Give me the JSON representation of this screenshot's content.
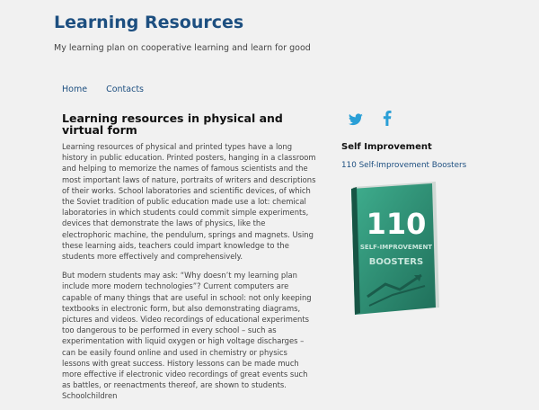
{
  "site": {
    "title": "Learning Resources",
    "tagline": "My learning plan on cooperative learning and learn for good"
  },
  "nav": {
    "items": [
      {
        "label": "Home"
      },
      {
        "label": "Contacts"
      }
    ]
  },
  "post": {
    "title": "Learning resources in physical and virtual form",
    "paragraphs": [
      "Learning resources of physical and printed types have a long history in public education. Printed posters, hanging in a classroom and helping to memorize the names of famous scientists and the most important laws of nature, portraits of writers and descriptions of their works. School laboratories and scientific devices, of which the Soviet tradition of public education made use a lot: chemical laboratories in which students could commit simple experiments, devices that demonstrate the laws of physics, like the electrophoric machine, the pendulum, springs and magnets. Using these learning aids, teachers could impart knowledge to the students more effectively and comprehensively.",
      "But modern students may ask: “Why doesn’t my learning plan include more modern technologies”? Current computers are capable of many things that are useful in school: not only keeping textbooks in electronic form, but also demonstrating diagrams, pictures and videos. Video recordings of educational experiments too dangerous to be performed in every school – such as experimentation with liquid oxygen or high voltage discharges – can be easily found online and used in chemistry or physics lessons with great success. History lessons can be made much more effective if electronic video recordings of great events such as battles, or reenactments thereof, are shown to students. Schoolchildren"
    ]
  },
  "sidebar": {
    "social_icons": [
      "twitter-icon",
      "facebook-icon"
    ],
    "widget_title": "Self Improvement",
    "widget_link": "110 Self-Improvement Boosters",
    "book": {
      "number": "110",
      "line1": "SELF-IMPROVEMENT",
      "line2": "BOOSTERS"
    }
  },
  "colors": {
    "background": "#f1f1f1",
    "title_blue": "#1d4f80",
    "social_blue": "#2a9fd6",
    "book_green": "#2a8a72"
  }
}
